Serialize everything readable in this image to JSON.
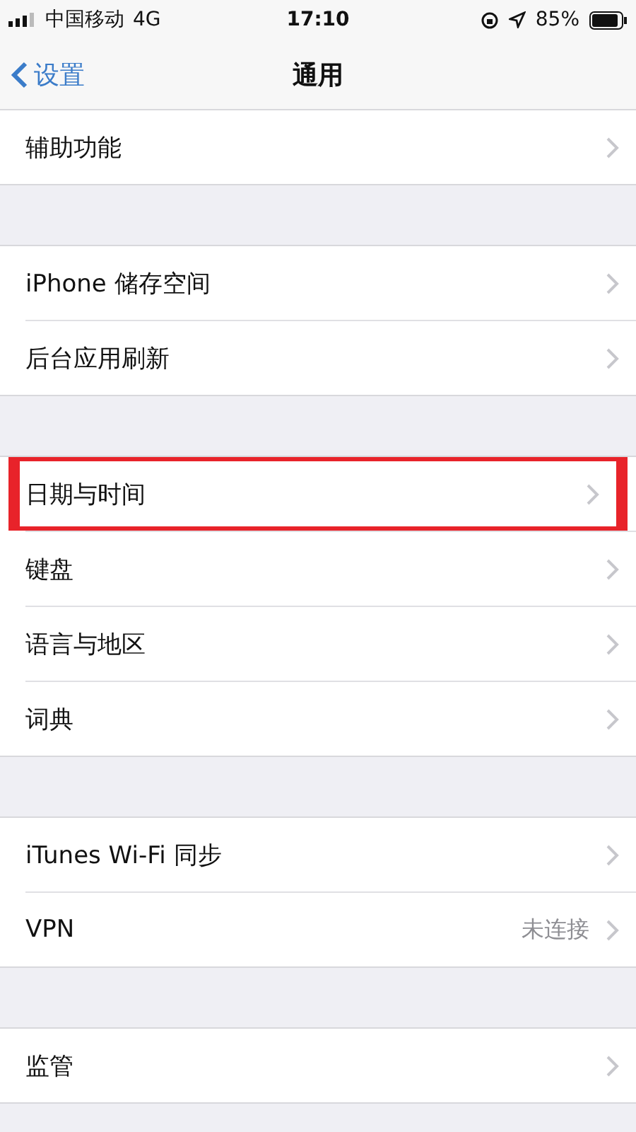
{
  "status_bar": {
    "carrier": "中国移动",
    "network": "4G",
    "time": "17:10",
    "battery": "85%"
  },
  "nav": {
    "back": "设置",
    "title": "通用"
  },
  "groups": [
    {
      "rows": [
        {
          "label": "辅助功能",
          "highlighted": false
        }
      ]
    },
    {
      "rows": [
        {
          "label": "iPhone 储存空间",
          "highlighted": false
        },
        {
          "label": "后台应用刷新",
          "highlighted": false
        }
      ]
    },
    {
      "rows": [
        {
          "label": "日期与时间",
          "highlighted": true
        },
        {
          "label": "键盘",
          "highlighted": false
        },
        {
          "label": "语言与地区",
          "highlighted": false
        },
        {
          "label": "词典",
          "highlighted": false
        }
      ]
    },
    {
      "rows": [
        {
          "label": "iTunes Wi-Fi 同步",
          "highlighted": false
        },
        {
          "label": "VPN",
          "value": "未连接",
          "highlighted": false
        }
      ]
    },
    {
      "rows": [
        {
          "label": "监管",
          "highlighted": false
        }
      ]
    }
  ]
}
